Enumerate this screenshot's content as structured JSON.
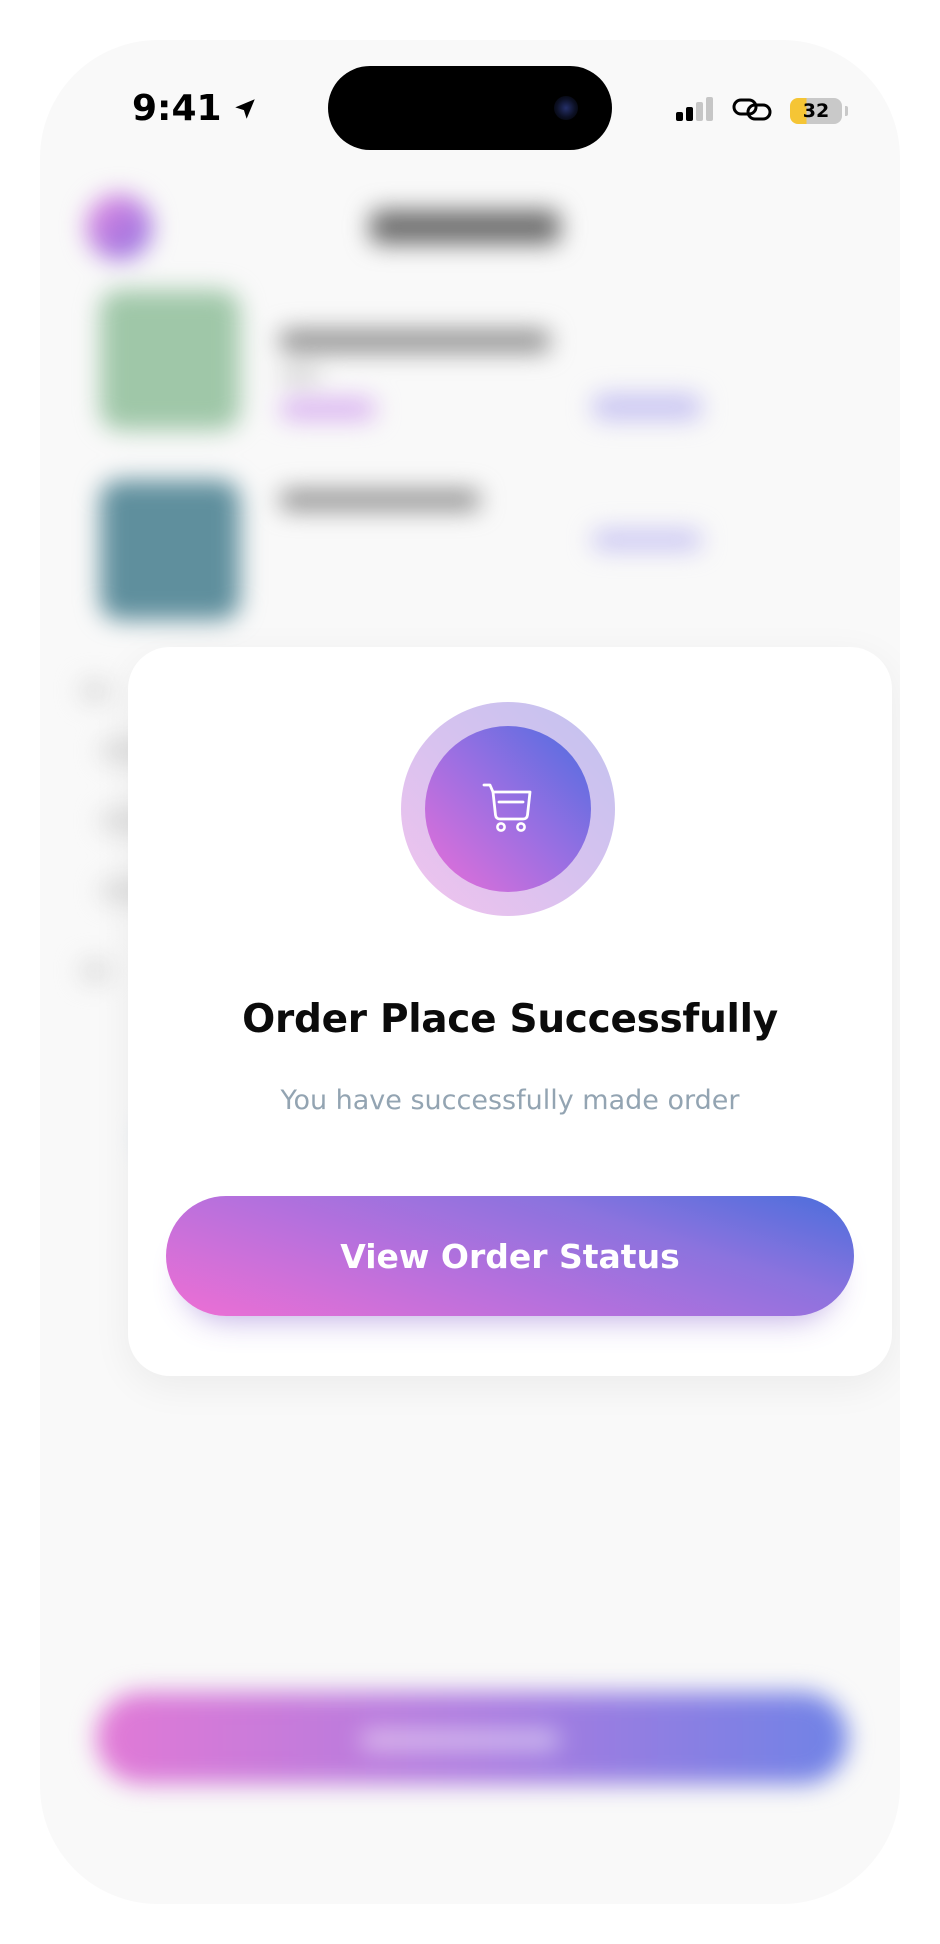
{
  "status_bar": {
    "time": "9:41",
    "battery_percent": "32",
    "icons": [
      "location-arrow-icon",
      "signal-icon",
      "link-icon",
      "battery-icon"
    ]
  },
  "modal": {
    "icon": "shopping-cart-icon",
    "title": "Order Place Successfully",
    "subtitle": "You have successfully made order",
    "button_label": "View Order Status"
  },
  "colors": {
    "gradient_pink": "#ee6fd4",
    "gradient_purple": "#9c6fe2",
    "gradient_blue": "#4a6edc",
    "subtitle_gray": "#93a4b2",
    "battery_yellow": "#f5c535"
  }
}
